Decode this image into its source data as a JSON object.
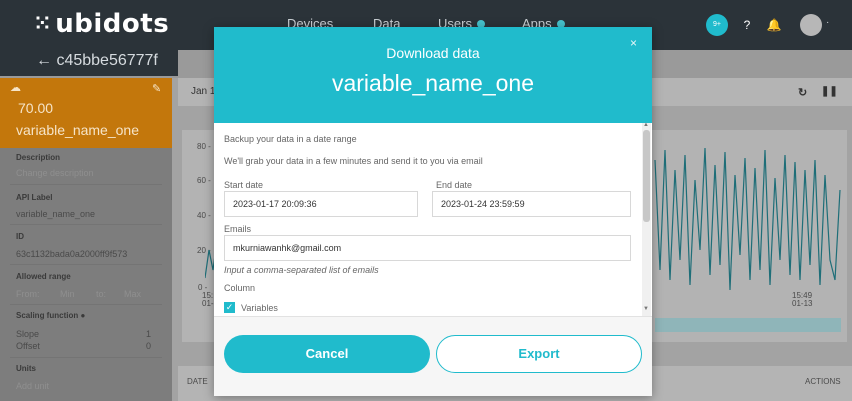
{
  "app": {
    "logo": "ubidots"
  },
  "nav": {
    "items": [
      "Devices",
      "Data",
      "Users",
      "Apps"
    ],
    "right_badge": "9+"
  },
  "device": {
    "title": "← c45bbe56777f"
  },
  "variable_card": {
    "value": "70.00",
    "name": "variable_name_one"
  },
  "sidebar": {
    "description_label": "Description",
    "description_value": "Change description",
    "api_label": "API Label",
    "api_value": "variable_name_one",
    "id_label": "ID",
    "id_value": "63c1132bada0a2000ff9f573",
    "range_label": "Allowed range",
    "range_from": "From:",
    "range_min": "Min",
    "range_to": "to:",
    "range_max": "Max",
    "scaling_label": "Scaling function",
    "slope_label": "Slope",
    "slope_value": "1",
    "offset_label": "Offset",
    "offset_value": "0",
    "units_label": "Units",
    "units_value": "Add unit"
  },
  "main": {
    "date_label": "Jan 1",
    "yticks": [
      "80 -",
      "60 -",
      "40 -",
      "20 -",
      "0 -"
    ],
    "xtick_left": [
      "15:",
      "01-"
    ],
    "xtick_right": [
      "15:49",
      "01-13"
    ],
    "table_date": "DATE",
    "table_actions": "ACTIONS"
  },
  "modal": {
    "title": "Download data",
    "variable": "variable_name_one",
    "close": "×",
    "intro1": "Backup your data in a date range",
    "intro2": "We'll grab your data in a few minutes and send it to you via email",
    "start_label": "Start date",
    "start_value": "2023-01-17 20:09:36",
    "end_label": "End date",
    "end_value": "2023-01-24 23:59:59",
    "emails_label": "Emails",
    "emails_value": "mkurniawanhk@gmail.com",
    "emails_hint": "Input a comma-separated list of emails",
    "column_label": "Column",
    "column_option": "Variables",
    "cancel": "Cancel",
    "export": "Export"
  },
  "colors": {
    "accent": "#20bbcc",
    "card": "#c3770c",
    "topbar": "#2b3339"
  }
}
